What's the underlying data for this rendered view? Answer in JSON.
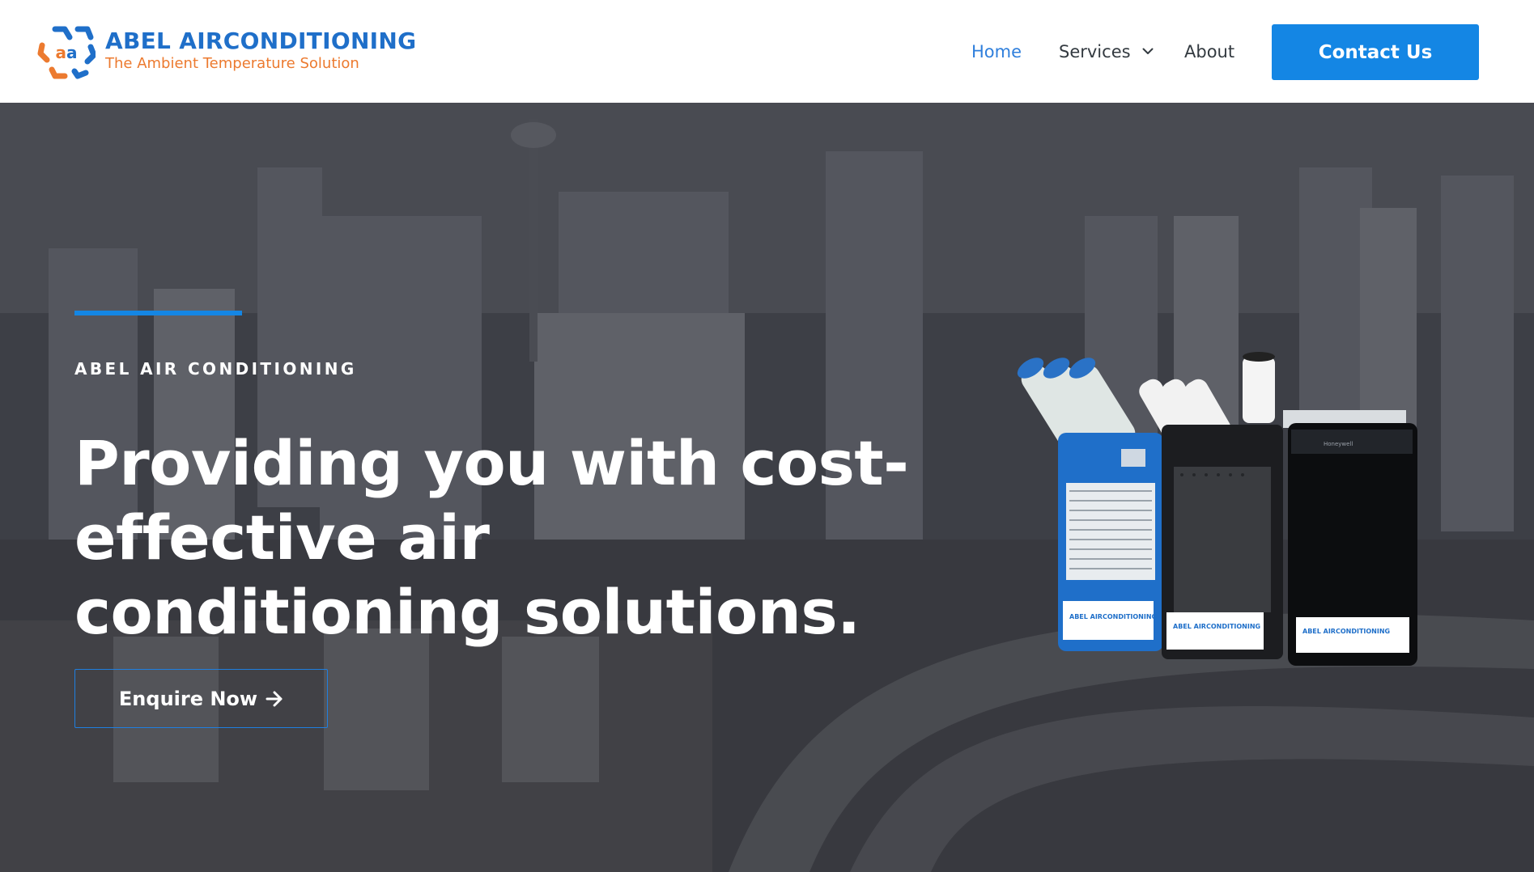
{
  "brand": {
    "name": "ABEL AIRCONDITIONING",
    "tagline": "The Ambient Temperature Solution",
    "logo_icon": "aa-snowflake-logo-icon",
    "color_primary": "#1f6fc9",
    "color_accent": "#ec7a2f"
  },
  "nav": {
    "items": [
      {
        "label": "Home",
        "active": true
      },
      {
        "label": "Services",
        "has_dropdown": true,
        "icon": "chevron-down-icon"
      },
      {
        "label": "About"
      }
    ],
    "cta_label": "Contact Us",
    "cta_color": "#1486e4"
  },
  "hero": {
    "eyebrow": "ABEL AIR CONDITIONING",
    "headline": "Providing you with cost-effective air conditioning solutions.",
    "button_label": "Enquire Now",
    "button_icon": "arrow-right-icon",
    "accent_color": "#1486e4",
    "background": "city-skyline-photo",
    "product_labels": [
      "ABEL AIRCONDITIONING",
      "ABEL AIRCONDITIONING",
      "ABEL AIRCONDITIONING"
    ]
  }
}
